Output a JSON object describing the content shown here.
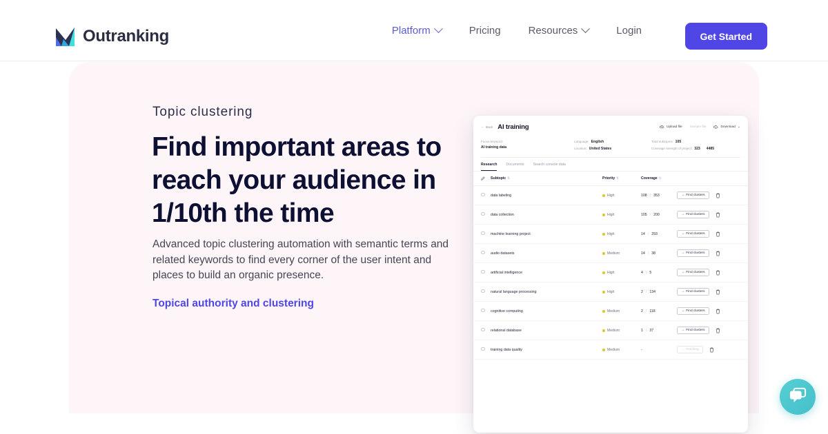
{
  "brand": {
    "name": "Outranking",
    "logo_icon": "mountain-chart-logo",
    "colors": {
      "dark": "#2b3253",
      "teal": "#3fdfe0",
      "blue": "#4f46e5"
    }
  },
  "nav": {
    "items": [
      {
        "label": "Platform",
        "has_dropdown": true,
        "active": true,
        "icon": "chevron-down-icon"
      },
      {
        "label": "Pricing",
        "has_dropdown": false,
        "active": false
      },
      {
        "label": "Resources",
        "has_dropdown": true,
        "active": false,
        "icon": "chevron-down-icon"
      },
      {
        "label": "Login",
        "has_dropdown": false,
        "active": false
      }
    ],
    "cta": {
      "label": "Get Started",
      "color": "#4f46e5"
    }
  },
  "hero": {
    "eyebrow": "Topic clustering",
    "headline": "Find important areas to reach your audience in 1/10th the time",
    "subcopy": "Advanced topic clustering automation with semantic terms and related keywords to find every corner of the user intent and places to build an organic presence.",
    "link": "Topical authority and clustering",
    "background": "#fdf5f8"
  },
  "app": {
    "back_label": "Back",
    "back_icon": "arrow-left-icon",
    "title": "AI training",
    "actions": [
      {
        "label": "Upload file",
        "icon": "upload-cloud-icon",
        "muted": false
      },
      {
        "label": "Sample file",
        "icon": "none",
        "muted": true
      },
      {
        "label": "Download",
        "icon": "download-cloud-icon",
        "muted": false,
        "chevron": "chevron-down-icon"
      }
    ],
    "meta": {
      "focus_keyword_label": "Focus keyword:",
      "focus_keyword_value": "AI training data",
      "language_label": "Language:",
      "language_value": "English",
      "location_label": "Location:",
      "location_value": "United States",
      "total_subtopics_label": "Total subtopics:",
      "total_subtopics_value": "105",
      "coverage_strength_label": "Coverage strength of project:",
      "coverage_strength_value": "323",
      "coverage_strength_total": "4485"
    },
    "tabs": [
      {
        "label": "Research",
        "selected": true
      },
      {
        "label": "Documents",
        "selected": false
      },
      {
        "label": "Search console data",
        "selected": false
      }
    ],
    "table": {
      "headers": {
        "edit_icon": "pencil-icon",
        "subtopic": "Subtopic",
        "priority": "Priority",
        "coverage": "Coverage",
        "sort_icon": "sort-updown-icon"
      },
      "rows": [
        {
          "subtopic": "data labeling",
          "priority": "High",
          "coverage_done": "108",
          "coverage_total": "353",
          "action": "Find clusters",
          "action_state": "enabled"
        },
        {
          "subtopic": "data collection",
          "priority": "High",
          "coverage_done": "105",
          "coverage_total": "200",
          "action": "Find clusters",
          "action_state": "enabled"
        },
        {
          "subtopic": "machine learning project",
          "priority": "High",
          "coverage_done": "14",
          "coverage_total": "293",
          "action": "Find clusters",
          "action_state": "enabled"
        },
        {
          "subtopic": "audio datasets",
          "priority": "Medium",
          "coverage_done": "14",
          "coverage_total": "38",
          "action": "Find clusters",
          "action_state": "enabled"
        },
        {
          "subtopic": "artificial intelligence",
          "priority": "High",
          "coverage_done": "4",
          "coverage_total": "5",
          "action": "Find clusters",
          "action_state": "enabled"
        },
        {
          "subtopic": "natural language processing",
          "priority": "High",
          "coverage_done": "2",
          "coverage_total": "134",
          "action": "Find clusters",
          "action_state": "enabled"
        },
        {
          "subtopic": "cognitive computing",
          "priority": "Medium",
          "coverage_done": "2",
          "coverage_total": "118",
          "action": "Find clusters",
          "action_state": "enabled"
        },
        {
          "subtopic": "relational database",
          "priority": "Medium",
          "coverage_done": "1",
          "coverage_total": "37",
          "action": "Find clusters",
          "action_state": "enabled"
        },
        {
          "subtopic": "training data quality",
          "priority": "Medium",
          "coverage_done": "-",
          "coverage_total": "",
          "action": "Fetching",
          "action_state": "disabled"
        }
      ],
      "row_icons": {
        "select": "radio-circle-icon",
        "delete": "trash-icon",
        "find": "arrow-right-icon"
      },
      "priority_dot_color": "#dcc62a"
    }
  },
  "chat_widget": {
    "icon": "chat-bubbles-icon",
    "color": "#4bc6ce"
  }
}
